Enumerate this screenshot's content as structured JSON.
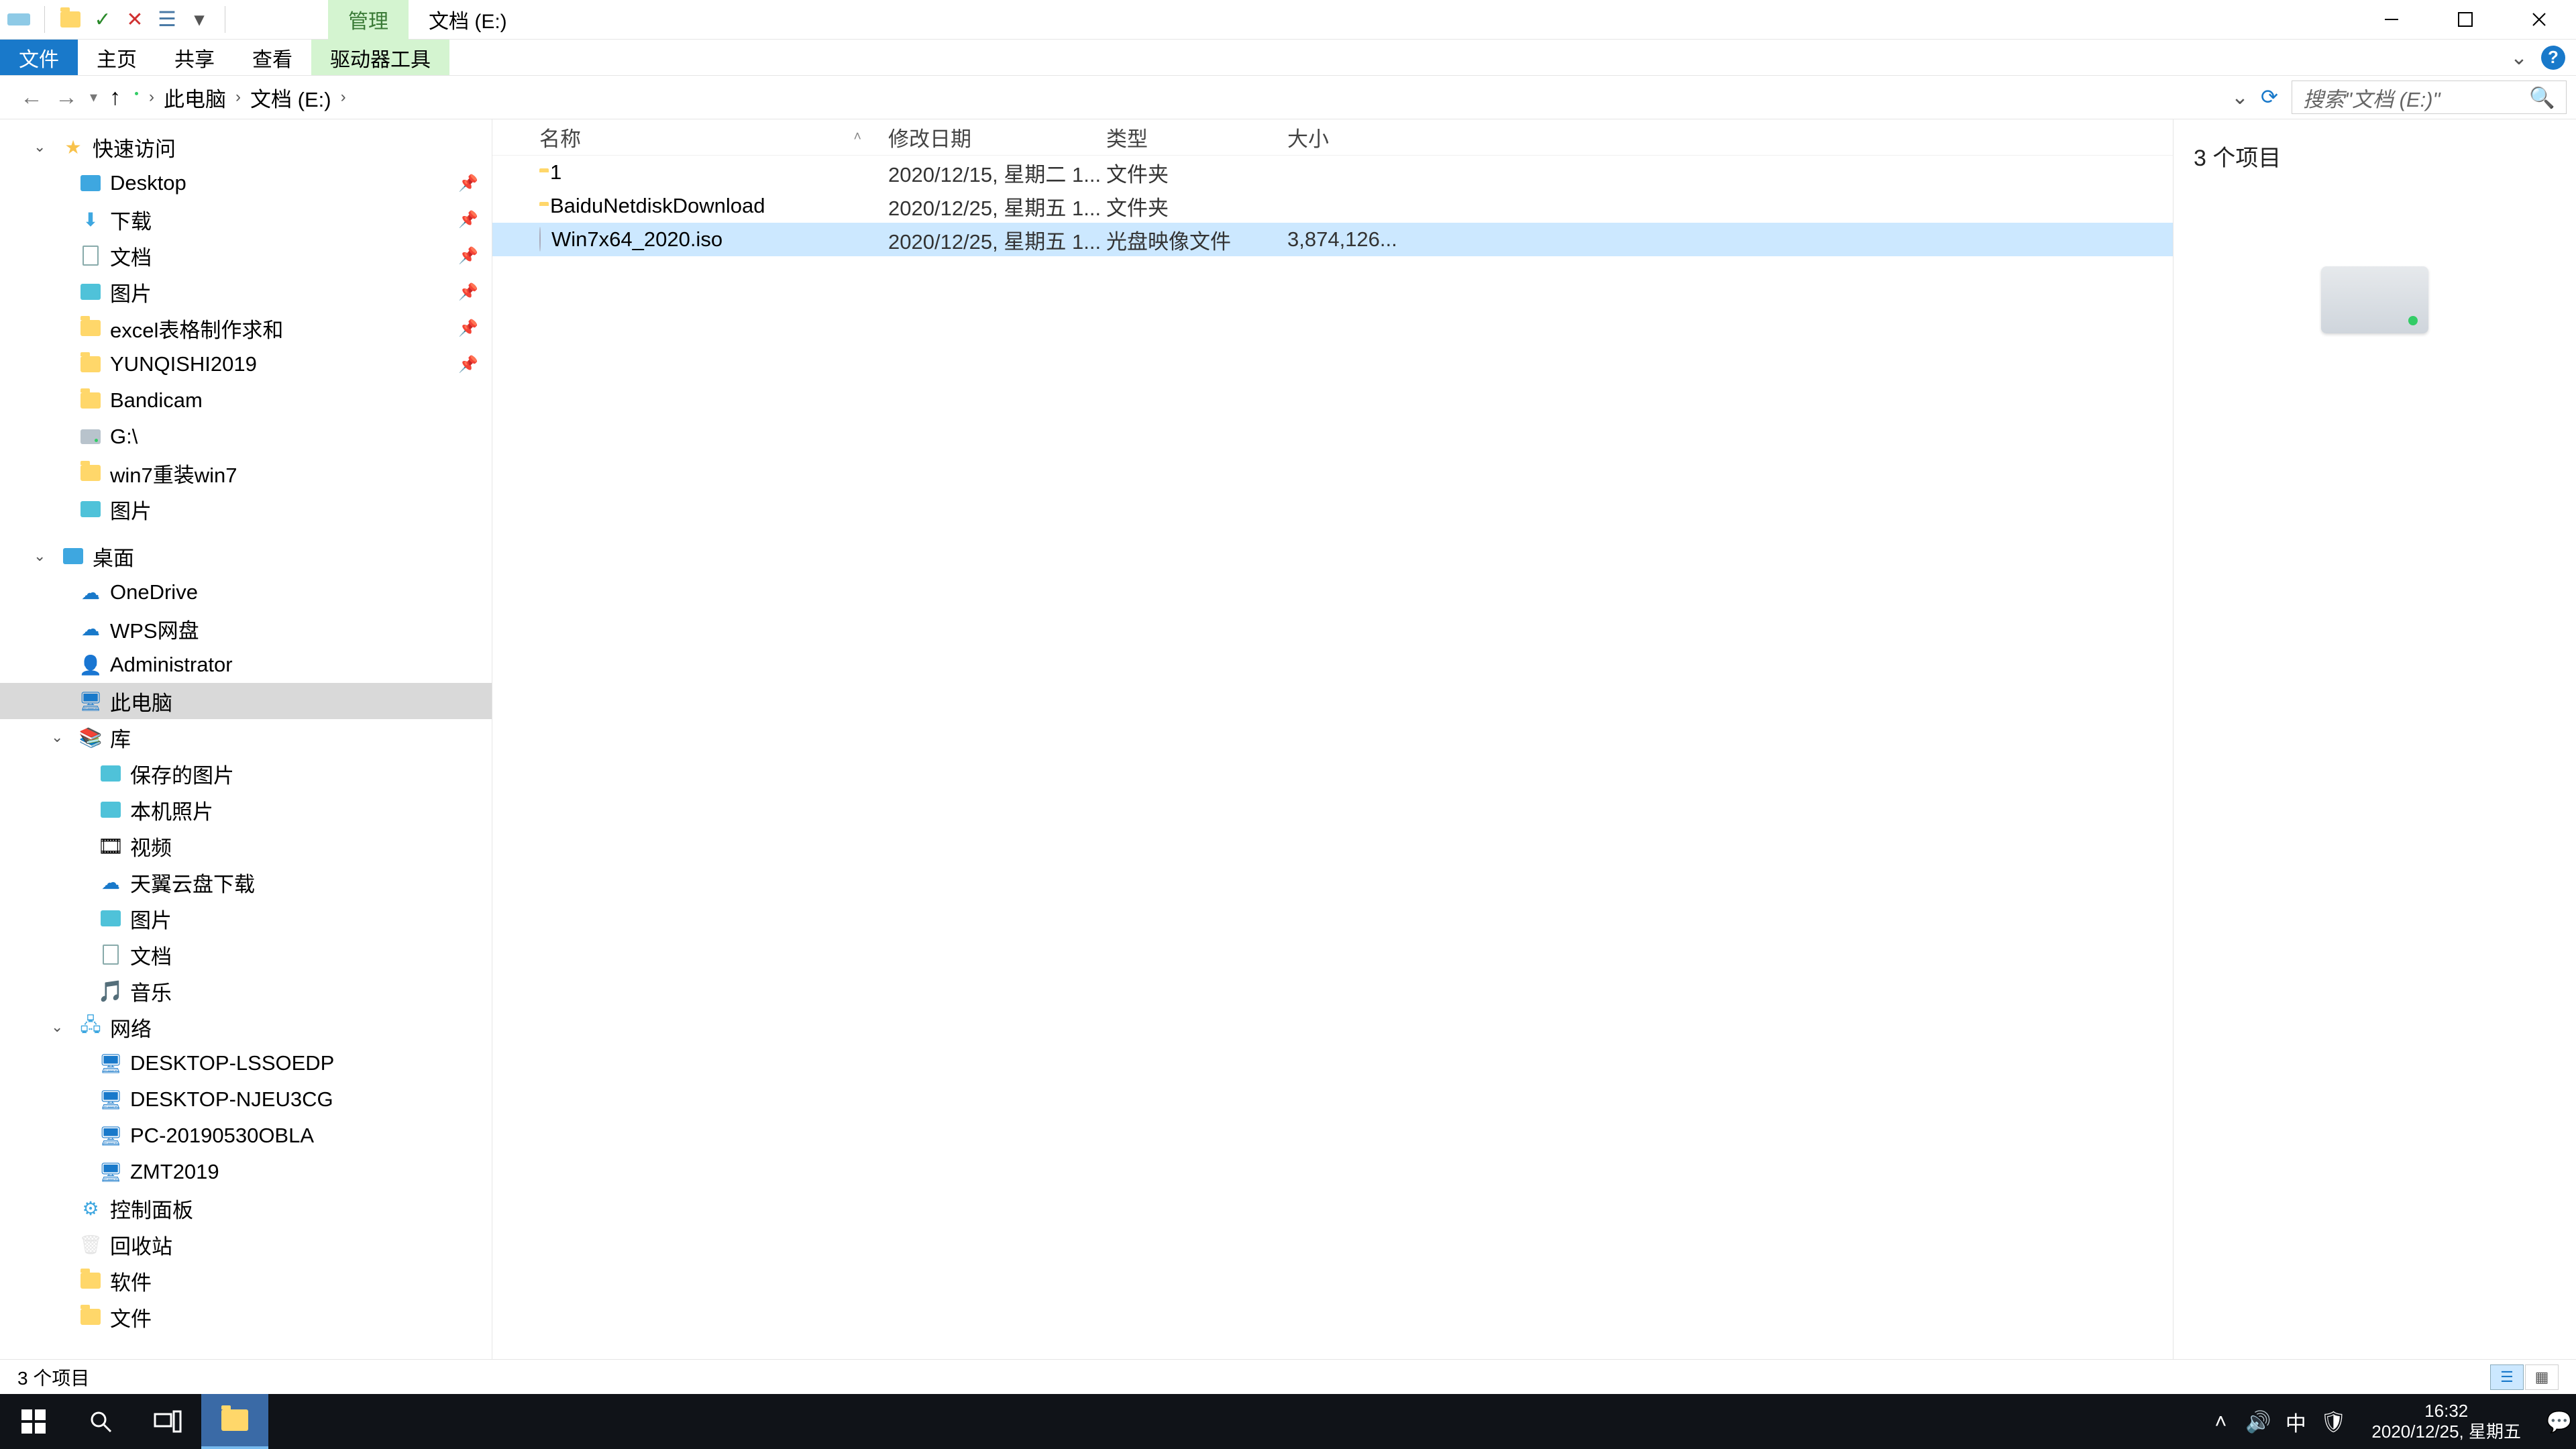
{
  "titlebar": {
    "ribbon_contextual": "管理",
    "location": "文档 (E:)"
  },
  "ribbon": {
    "file": "文件",
    "home": "主页",
    "share": "共享",
    "view": "查看",
    "drive_tools": "驱动器工具"
  },
  "breadcrumb": {
    "pc": "此电脑",
    "drive": "文档 (E:)"
  },
  "search": {
    "placeholder": "搜索\"文档 (E:)\""
  },
  "sidebar": {
    "quick_access": "快速访问",
    "desktop": "Desktop",
    "downloads": "下载",
    "documents": "文档",
    "pictures": "图片",
    "excel": "excel表格制作求和",
    "yunqishi": "YUNQISHI2019",
    "bandicam": "Bandicam",
    "gdrive": "G:\\",
    "win7reinstall": "win7重装win7",
    "pictures2": "图片",
    "desktop_cn": "桌面",
    "onedrive": "OneDrive",
    "wps": "WPS网盘",
    "admin": "Administrator",
    "thispc": "此电脑",
    "library": "库",
    "saved_pics": "保存的图片",
    "camera_roll": "本机照片",
    "videos": "视频",
    "tianyi": "天翼云盘下载",
    "pictures3": "图片",
    "documents2": "文档",
    "music": "音乐",
    "network": "网络",
    "net1": "DESKTOP-LSSOEDP",
    "net2": "DESKTOP-NJEU3CG",
    "net3": "PC-20190530OBLA",
    "net4": "ZMT2019",
    "control_panel": "控制面板",
    "recycle": "回收站",
    "software": "软件",
    "files": "文件"
  },
  "columns": {
    "name": "名称",
    "date": "修改日期",
    "type": "类型",
    "size": "大小"
  },
  "rows": [
    {
      "name": "1",
      "date": "2020/12/15, 星期二 1...",
      "type": "文件夹",
      "size": "",
      "icon": "folder"
    },
    {
      "name": "BaiduNetdiskDownload",
      "date": "2020/12/25, 星期五 1...",
      "type": "文件夹",
      "size": "",
      "icon": "folder"
    },
    {
      "name": "Win7x64_2020.iso",
      "date": "2020/12/25, 星期五 1...",
      "type": "光盘映像文件",
      "size": "3,874,126...",
      "icon": "disc",
      "selected": true
    }
  ],
  "preview": {
    "count": "3 个项目"
  },
  "statusbar": {
    "count": "3 个项目"
  },
  "taskbar": {
    "time": "16:32",
    "date": "2020/12/25, 星期五",
    "ime": "中"
  }
}
